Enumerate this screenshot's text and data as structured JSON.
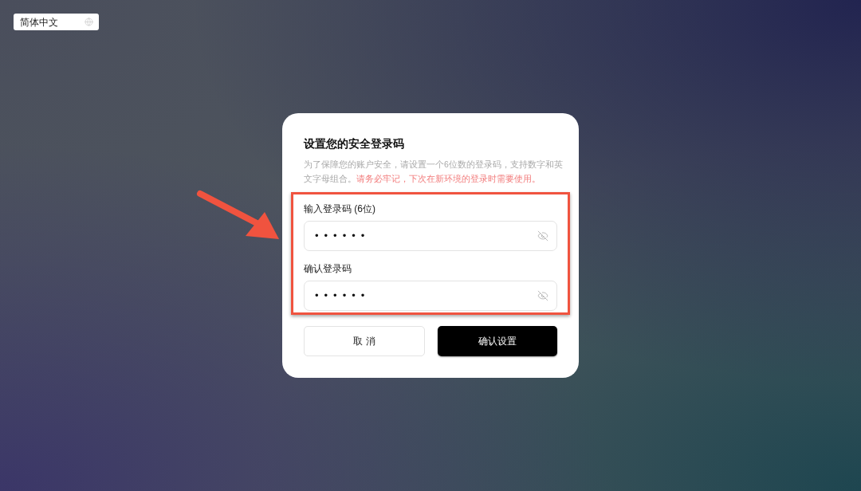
{
  "language_selector": {
    "label": "简体中文"
  },
  "dialog": {
    "title": "设置您的安全登录码",
    "description": {
      "text": "为了保障您的账户安全，请设置一个6位数的登录码，支持数字和英文字母组合。",
      "warning": "请务必牢记，下次在新环境的登录时需要使用。"
    },
    "fields": [
      {
        "label": "输入登录码 (6位)",
        "value": "••••••",
        "masked": true
      },
      {
        "label": "确认登录码",
        "value": "••••••",
        "masked": true
      }
    ],
    "buttons": [
      {
        "label": "取 消",
        "kind": "secondary"
      },
      {
        "label": "确认设置",
        "kind": "primary"
      }
    ]
  }
}
